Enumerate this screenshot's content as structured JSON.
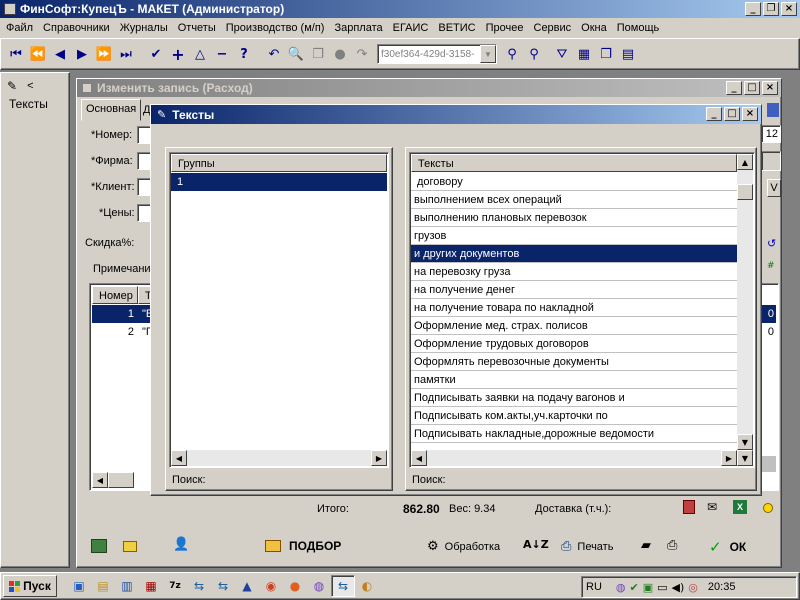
{
  "app": {
    "title": "ФинСофт:КупецЪ - МАКЕТ  (Администратор)",
    "menu": [
      "Файл",
      "Справочники",
      "Журналы",
      "Отчеты",
      "Производство (м/п)",
      "Зарплата",
      "ЕГАИС",
      "ВЕТИС",
      "Прочее",
      "Сервис",
      "Окна",
      "Помощь"
    ],
    "toolbar_guid": "f30ef364-429d-3158-"
  },
  "left_panel": {
    "label": "Тексты",
    "arrow": "<"
  },
  "edit_window": {
    "title": "Изменить запись (Расход)",
    "tab_main": "Основная",
    "tab_second": "Д",
    "field_labels": [
      "*Номер:",
      "*Фирма:",
      "*Клиент:",
      "*Цены:"
    ],
    "discount_label": "Скидка%:",
    "note_label": "Примечани",
    "right_value": "12",
    "right_v": "V",
    "grid_header_num": "Номер",
    "grid_header_t": "Т",
    "grid_rows": [
      {
        "num": "1",
        "t": "\"Е"
      },
      {
        "num": "2",
        "t": "\"Г"
      }
    ],
    "grid_right_vals": [
      "0",
      "0"
    ],
    "total_label": "Итого:",
    "total_value": "862.80",
    "weight_label": "Вес: 9.34",
    "delivery_label": "Доставка (т.ч.):",
    "btn_podbor": "ПОДБОР",
    "btn_obrabotka": "Обработка",
    "btn_print": "Печать",
    "btn_ok": "ОК"
  },
  "texts_dialog": {
    "title": "Тексты",
    "groups_header": "Группы",
    "groups": [
      "1"
    ],
    "texts_header": "Тексты",
    "texts": [
      "договору",
      "выполнением всех операций",
      "выполнению плановых перевозок",
      "грузов",
      "и других документов",
      "на перевозку груза",
      "на получение денег",
      "на получение товара по накладной",
      "Оформление мед. страх. полисов",
      "Оформление трудовых договоров",
      "Оформлять перевозочные документы",
      "памятки",
      "Подписывать заявки на подачу вагонов и",
      "Подписывать ком.акты,уч.карточки по",
      "Подписывать накладные,дорожные ведомости"
    ],
    "selected_index": 4,
    "search_label": "Поиск:"
  },
  "taskbar": {
    "start": "Пуск",
    "lang": "RU",
    "time": "20:35"
  },
  "colors": {
    "title_active": "#0a246a",
    "selection": "#0a246a",
    "face": "#d4d0c8"
  }
}
